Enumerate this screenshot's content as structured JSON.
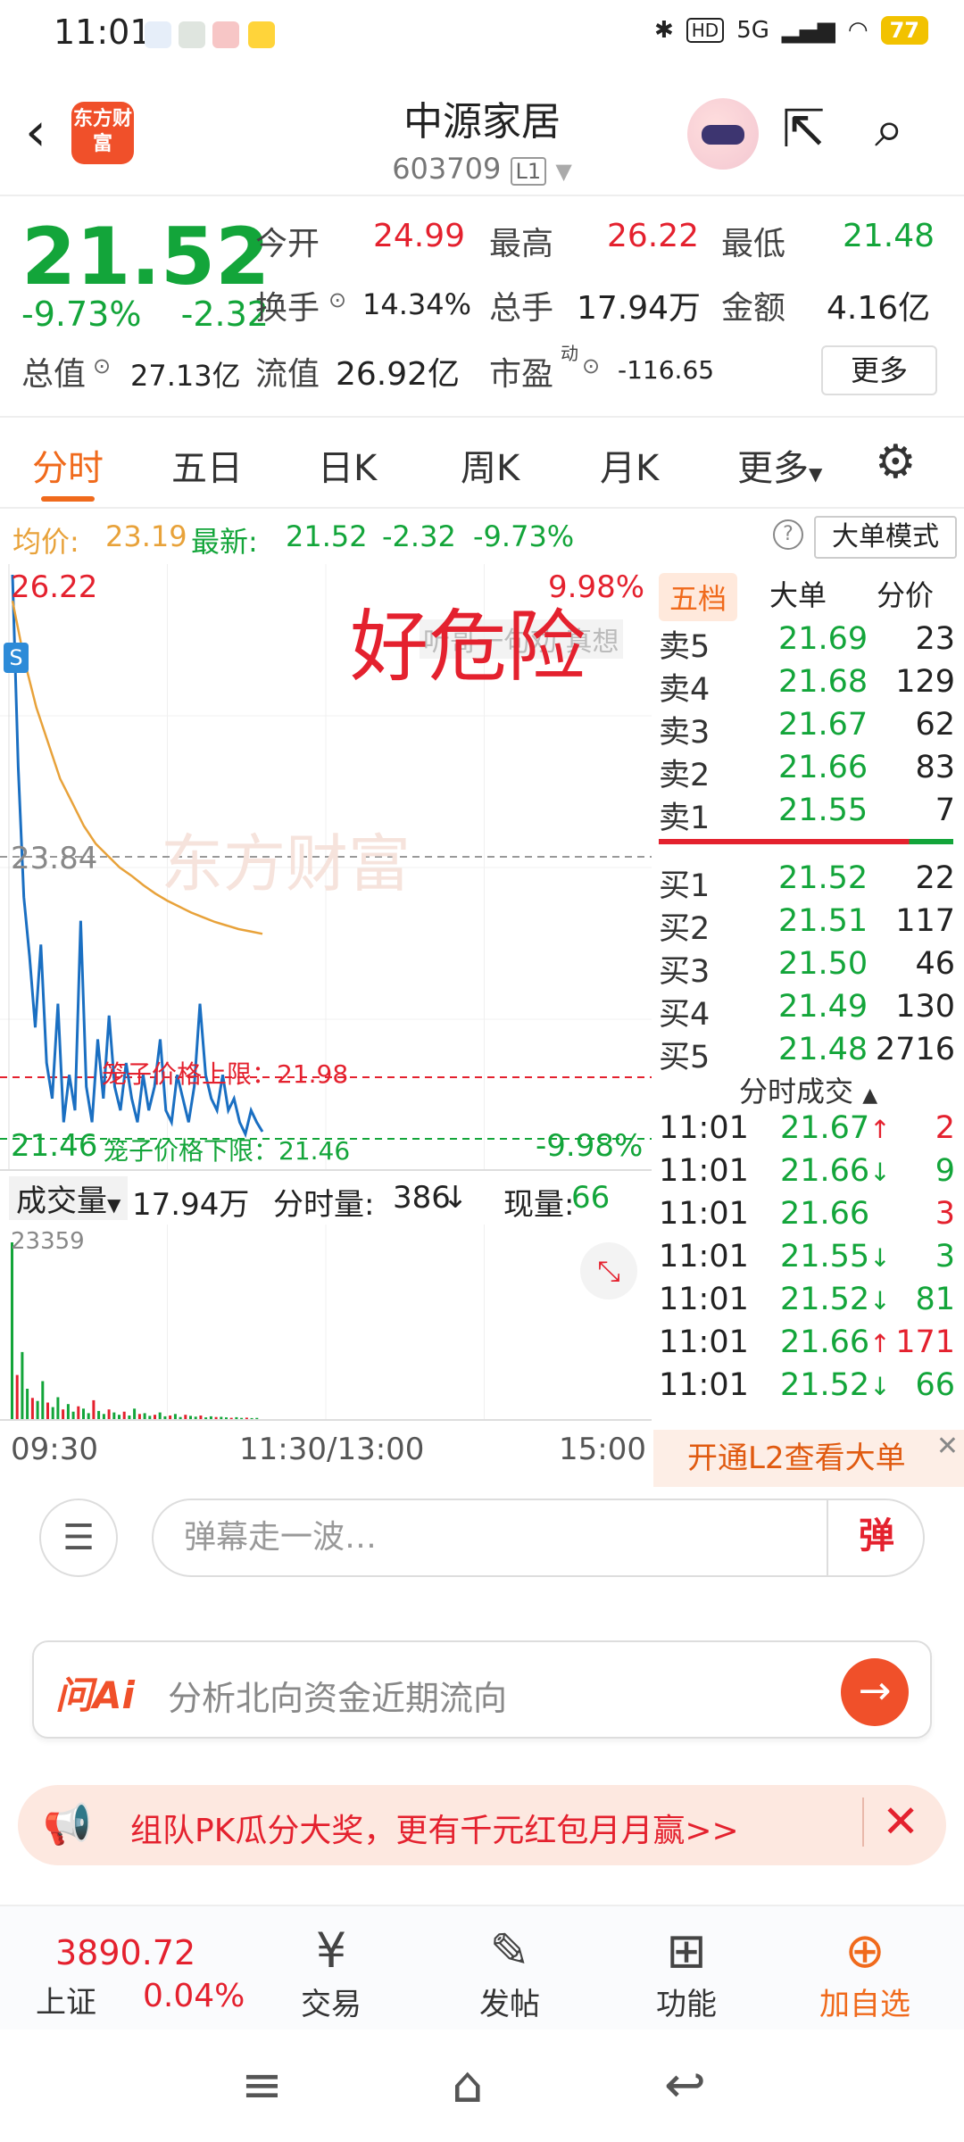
{
  "status_bar": {
    "time": "11:01",
    "network": "5G",
    "battery": "77"
  },
  "header": {
    "back_icon": "chevron-left-icon",
    "logo_text": "东方财富",
    "stock_name": "中源家居",
    "stock_code": "603709",
    "level_badge": "L1"
  },
  "quote": {
    "price": "21.52",
    "change_pct": "-9.73%",
    "change": "-2.32",
    "open_label": "今开",
    "open": "24.99",
    "high_label": "最高",
    "high": "26.22",
    "low_label": "最低",
    "low": "21.48",
    "turnover_label": "换手",
    "turnover": "14.34%",
    "volume_label": "总手",
    "volume": "17.94万",
    "amount_label": "金额",
    "amount": "4.16亿",
    "mktcap_label": "总值",
    "mktcap": "27.13亿",
    "float_label": "流值",
    "float_cap": "26.92亿",
    "pe_label": "市盈",
    "pe_sup": "动",
    "pe": "-116.65",
    "more_label": "更多"
  },
  "tabs": {
    "items": [
      "分时",
      "五日",
      "日K",
      "周K",
      "月K"
    ],
    "more": "更多"
  },
  "avg_row": {
    "avg_label": "均价:",
    "avg_value": "23.19",
    "latest_label": "最新:",
    "latest_value": "21.52",
    "latest_change": "-2.32",
    "latest_pct": "-9.73%",
    "big_order_mode": "大单模式"
  },
  "chart": {
    "high_label": "26.22",
    "high_pct": "9.98%",
    "mid_label": "23.84",
    "low_label": "21.46",
    "low_pct": "-9.98%",
    "overlay_text": "好危险",
    "danmu_text": "听哥一句劝 真想",
    "cage_upper": "笼子价格上限：21.98",
    "cage_lower": "笼子价格下限：21.46",
    "s_marker": "S",
    "watermark": "东方财富"
  },
  "chart_data": {
    "type": "line",
    "title": "",
    "ylim": [
      21.46,
      26.22
    ],
    "x_ticks": [
      "09:30",
      "11:30/13:00",
      "15:00"
    ],
    "series": [
      {
        "name": "",
        "color": "#1a6fc2",
        "values": [
          26.22,
          24.6,
          23.5,
          23.0,
          22.4,
          23.1,
          22.1,
          21.8,
          22.6,
          21.6,
          22.0,
          21.7,
          23.3,
          21.9,
          21.6,
          22.3,
          21.8,
          22.5,
          21.9,
          21.7,
          22.1,
          21.8,
          21.6,
          22.0,
          21.7,
          21.9,
          22.3,
          21.7,
          21.6,
          22.0,
          21.8,
          21.6,
          21.9,
          22.6,
          22.0,
          21.8,
          21.7,
          22.0,
          21.7,
          21.8,
          21.6,
          21.5,
          21.7,
          21.6,
          21.52
        ]
      },
      {
        "name": "",
        "color": "#e8a23a",
        "values": [
          26.0,
          25.5,
          25.1,
          24.8,
          24.5,
          24.3,
          24.1,
          23.95,
          23.85,
          23.75,
          23.68,
          23.6,
          23.53,
          23.47,
          23.42,
          23.37,
          23.33,
          23.29,
          23.26,
          23.23,
          23.21,
          23.19
        ]
      }
    ],
    "reference_lines": [
      23.84,
      21.98,
      21.46
    ],
    "volume_max": "23359",
    "volume_bars": [
      23359,
      6000,
      9000,
      4200,
      3000,
      2600,
      5200,
      2400,
      1800,
      3100,
      1500,
      2200,
      1200,
      1900,
      1600,
      1000,
      2700,
      1300,
      900,
      1500,
      1100,
      800,
      1200,
      700,
      1600,
      900,
      1000,
      650,
      800,
      1100,
      600,
      700,
      900,
      500,
      800,
      650,
      550,
      700,
      450,
      600,
      500,
      520,
      450,
      400,
      480,
      380,
      420,
      360,
      386
    ]
  },
  "order_book": {
    "tabs": [
      "五档",
      "大单",
      "分价"
    ],
    "asks": [
      {
        "label": "卖5",
        "price": "21.69",
        "vol": "23"
      },
      {
        "label": "卖4",
        "price": "21.68",
        "vol": "129"
      },
      {
        "label": "卖3",
        "price": "21.67",
        "vol": "62"
      },
      {
        "label": "卖2",
        "price": "21.66",
        "vol": "83"
      },
      {
        "label": "卖1",
        "price": "21.55",
        "vol": "7"
      }
    ],
    "bids": [
      {
        "label": "买1",
        "price": "21.52",
        "vol": "22"
      },
      {
        "label": "买2",
        "price": "21.51",
        "vol": "117"
      },
      {
        "label": "买3",
        "price": "21.50",
        "vol": "46"
      },
      {
        "label": "买4",
        "price": "21.49",
        "vol": "130"
      },
      {
        "label": "买5",
        "price": "21.48",
        "vol": "2716"
      }
    ],
    "trades_title": "分时成交",
    "trades": [
      {
        "time": "11:01",
        "price": "21.67",
        "dir": "↑",
        "vol": "2",
        "up": true
      },
      {
        "time": "11:01",
        "price": "21.66",
        "dir": "↓",
        "vol": "9",
        "up": false
      },
      {
        "time": "11:01",
        "price": "21.66",
        "dir": "",
        "vol": "3",
        "up": true
      },
      {
        "time": "11:01",
        "price": "21.55",
        "dir": "↓",
        "vol": "3",
        "up": false
      },
      {
        "time": "11:01",
        "price": "21.52",
        "dir": "↓",
        "vol": "81",
        "up": false
      },
      {
        "time": "11:01",
        "price": "21.66",
        "dir": "↑",
        "vol": "171",
        "up": true
      },
      {
        "time": "11:01",
        "price": "21.52",
        "dir": "↓",
        "vol": "66",
        "up": false
      }
    ],
    "l2_banner": "开通L2查看大单"
  },
  "volume_row": {
    "label": "成交量",
    "total": "17.94万",
    "tick_label": "分时量:",
    "tick_value": "386",
    "tick_arrow": "↓",
    "now_label": "现量:",
    "now_value": "66"
  },
  "time_axis": [
    "09:30",
    "11:30/13:00",
    "15:00"
  ],
  "danmu_bar": {
    "placeholder": "弹幕走一波…",
    "send_label": "弹"
  },
  "ask_ai": {
    "brand": "问Ai",
    "prompt": "分析北向资金近期流向"
  },
  "promo": {
    "text": "组队PK瓜分大奖，更有千元红包月月赢>>"
  },
  "bottom_nav": {
    "index_value": "3890.72",
    "index_name": "上证",
    "index_change": "0.04%",
    "items": [
      "交易",
      "发帖",
      "功能",
      "加自选"
    ]
  },
  "colors": {
    "up": "#e4212e",
    "down": "#13a53a",
    "accent": "#f06a1c",
    "price_line": "#1a6fc2",
    "avg_line": "#e8a23a"
  }
}
